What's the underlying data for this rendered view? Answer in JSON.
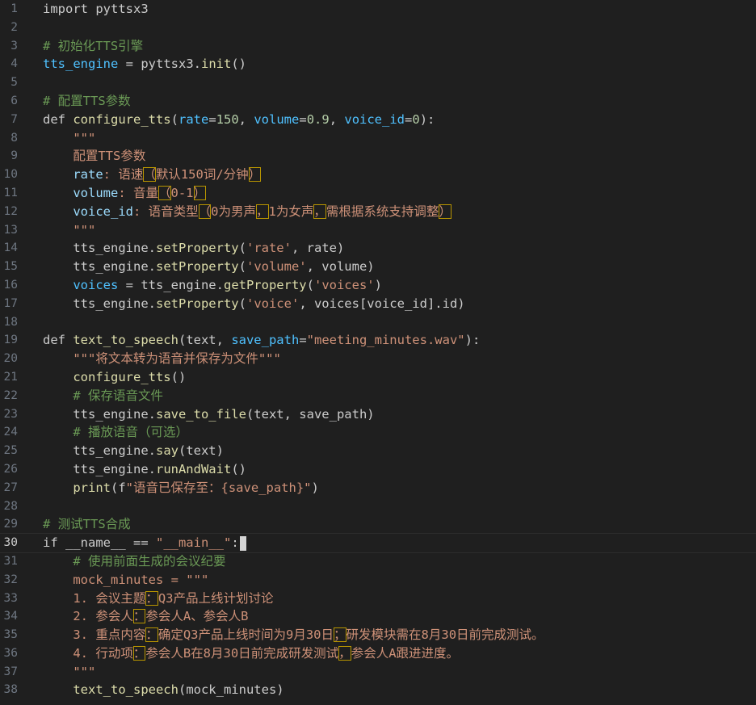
{
  "editor": {
    "active_line": 30,
    "lines": [
      {
        "n": "1",
        "text": "import pyttsx3"
      },
      {
        "n": "2",
        "text": ""
      },
      {
        "n": "3",
        "text": "# 初始化TTS引擎"
      },
      {
        "n": "4",
        "text": "tts_engine = pyttsx3.init()"
      },
      {
        "n": "5",
        "text": ""
      },
      {
        "n": "6",
        "text": "# 配置TTS参数"
      },
      {
        "n": "7",
        "text": "def configure_tts(rate=150, volume=0.9, voice_id=0):"
      },
      {
        "n": "8",
        "text": "    \"\"\""
      },
      {
        "n": "9",
        "text": "    配置TTS参数"
      },
      {
        "n": "10",
        "text": "    rate: 语速（默认150词/分钟）"
      },
      {
        "n": "11",
        "text": "    volume: 音量（0-1）"
      },
      {
        "n": "12",
        "text": "    voice_id: 语音类型（0为男声，1为女声，需根据系统支持调整）"
      },
      {
        "n": "13",
        "text": "    \"\"\""
      },
      {
        "n": "14",
        "text": "    tts_engine.setProperty('rate', rate)"
      },
      {
        "n": "15",
        "text": "    tts_engine.setProperty('volume', volume)"
      },
      {
        "n": "16",
        "text": "    voices = tts_engine.getProperty('voices')"
      },
      {
        "n": "17",
        "text": "    tts_engine.setProperty('voice', voices[voice_id].id)"
      },
      {
        "n": "18",
        "text": ""
      },
      {
        "n": "19",
        "text": "def text_to_speech(text, save_path=\"meeting_minutes.wav\"):"
      },
      {
        "n": "20",
        "text": "    \"\"\"将文本转为语音并保存为文件\"\"\""
      },
      {
        "n": "21",
        "text": "    configure_tts()"
      },
      {
        "n": "22",
        "text": "    # 保存语音文件"
      },
      {
        "n": "23",
        "text": "    tts_engine.save_to_file(text, save_path)"
      },
      {
        "n": "24",
        "text": "    # 播放语音（可选）"
      },
      {
        "n": "25",
        "text": "    tts_engine.say(text)"
      },
      {
        "n": "26",
        "text": "    tts_engine.runAndWait()"
      },
      {
        "n": "27",
        "text": "    print(f\"语音已保存至：{save_path}\")"
      },
      {
        "n": "28",
        "text": ""
      },
      {
        "n": "29",
        "text": "# 测试TTS合成"
      },
      {
        "n": "30",
        "text": "if __name__ == \"__main__\":"
      },
      {
        "n": "31",
        "text": "    # 使用前面生成的会议纪要"
      },
      {
        "n": "32",
        "text": "    mock_minutes = \"\"\""
      },
      {
        "n": "33",
        "text": "    1. 会议主题：Q3产品上线计划讨论"
      },
      {
        "n": "34",
        "text": "    2. 参会人：参会人A、参会人B"
      },
      {
        "n": "35",
        "text": "    3. 重点内容：确定Q3产品上线时间为9月30日；研发模块需在8月30日前完成测试。"
      },
      {
        "n": "36",
        "text": "    4. 行动项：参会人B在8月30日前完成研发测试，参会人A跟进进度。"
      },
      {
        "n": "37",
        "text": "    \"\"\""
      },
      {
        "n": "38",
        "text": "    text_to_speech(mock_minutes)"
      }
    ]
  },
  "colors": {
    "background": "#1f1f1f",
    "comment": "#6a9955",
    "string": "#ce9178",
    "function": "#dcdcaa",
    "variable": "#4fc1ff",
    "number": "#b5cea8",
    "bracket": "#ffd700",
    "highlight_box": "#b89500"
  }
}
